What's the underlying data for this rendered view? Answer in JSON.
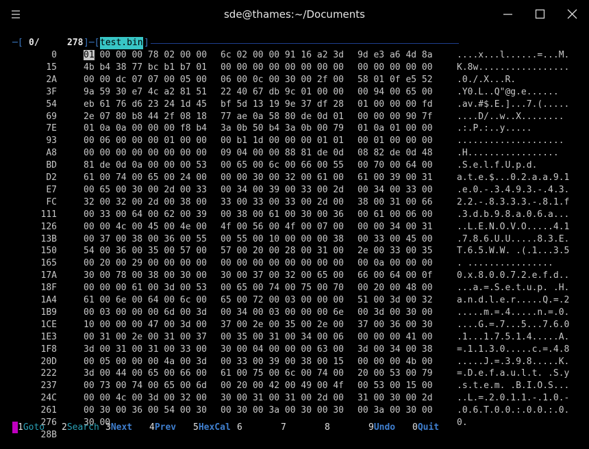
{
  "window": {
    "title": "sde@thames:~/Documents"
  },
  "header": {
    "lead": "─[",
    "offset": "0/",
    "size": "278",
    "mid": "]─[",
    "filename": "test.bin",
    "tail": "]"
  },
  "rows": [
    {
      "offset": "0",
      "g1": "01 00 00 00 78 02 00 00",
      "g2": "6c 02 00 00 91 16 a2 3d",
      "g3": "9d e3 a6 4d 8a",
      "ascii": "....x...l......=...M."
    },
    {
      "offset": "15",
      "g1": "4b b4 38 77 bc b1 b7 01",
      "g2": "00 00 00 00 00 00 00 00",
      "g3": "00 00 00 00 00",
      "ascii": "K.8w................."
    },
    {
      "offset": "2A",
      "g1": "00 00 dc 07 07 00 05 00",
      "g2": "06 00 0c 00 30 00 2f 00",
      "g3": "58 01 0f e5 52",
      "ascii": ".0./.X...R."
    },
    {
      "offset": "3F",
      "g1": "9a 59 30 e7 4c a2 81 51",
      "g2": "22 40 67 db 9c 01 00 00",
      "g3": "00 94 00 65 00",
      "ascii": ".Y0.L..Q\"@g.e......"
    },
    {
      "offset": "54",
      "g1": "eb 61 76 d6 23 24 1d 45",
      "g2": "bf 5d 13 19 9e 37 df 28",
      "g3": "01 00 00 00 fd",
      "ascii": ".av.#$.E.]...7.(....."
    },
    {
      "offset": "69",
      "g1": "2e 07 80 b8 44 2f 08 18",
      "g2": "77 ae 0a 58 80 de 0d 01",
      "g3": "00 00 00 90 7f",
      "ascii": "....D/..w..X........"
    },
    {
      "offset": "7E",
      "g1": "01 0a 0a 00 00 00 f8 b4",
      "g2": "3a 0b 50 b4 3a 0b 00 79",
      "g3": "01 0a 01 00 00",
      "ascii": ".:.P.:..y....."
    },
    {
      "offset": "93",
      "g1": "00 06 00 00 00 01 00 00",
      "g2": "00 b1 1d 00 00 00 01 01",
      "g3": "00 01 00 00 00",
      "ascii": "...................."
    },
    {
      "offset": "A8",
      "g1": "00 00 00 00 00 00 00 00",
      "g2": "09 04 00 00 88 81 de 0d",
      "g3": "08 82 de 0d 48",
      "ascii": ".H................."
    },
    {
      "offset": "BD",
      "g1": "81 de 0d 0a 00 00 00 53",
      "g2": "00 65 00 6c 00 66 00 55",
      "g3": "00 70 00 64 00",
      "ascii": ".S.e.l.f.U.p.d."
    },
    {
      "offset": "D2",
      "g1": "61 00 74 00 65 00 24 00",
      "g2": "00 00 30 00 32 00 61 00",
      "g3": "61 00 39 00 31",
      "ascii": "a.t.e.$...0.2.a.a.9.1"
    },
    {
      "offset": "E7",
      "g1": "00 65 00 30 00 2d 00 33",
      "g2": "00 34 00 39 00 33 00 2d",
      "g3": "00 34 00 33 00",
      "ascii": ".e.0.-.3.4.9.3.-.4.3."
    },
    {
      "offset": "FC",
      "g1": "32 00 32 00 2d 00 38 00",
      "g2": "33 00 33 00 33 00 2d 00",
      "g3": "38 00 31 00 66",
      "ascii": "2.2.-.8.3.3.3.-.8.1.f"
    },
    {
      "offset": "111",
      "g1": "00 33 00 64 00 62 00 39",
      "g2": "00 38 00 61 00 30 00 36",
      "g3": "00 61 00 06 00",
      "ascii": ".3.d.b.9.8.a.0.6.a..."
    },
    {
      "offset": "126",
      "g1": "00 00 4c 00 45 00 4e 00",
      "g2": "4f 00 56 00 4f 00 07 00",
      "g3": "00 00 34 00 31",
      "ascii": "..L.E.N.O.V.O.....4.1"
    },
    {
      "offset": "13B",
      "g1": "00 37 00 38 00 36 00 55",
      "g2": "00 55 00 10 00 00 00 38",
      "g3": "00 33 00 45 00",
      "ascii": ".7.8.6.U.U.....8.3.E."
    },
    {
      "offset": "150",
      "g1": "54 00 36 00 35 00 57 00",
      "g2": "57 00 20 00 28 00 31 00",
      "g3": "2e 00 33 00 35",
      "ascii": "T.6.5.W.W. .(.1...3.5"
    },
    {
      "offset": "165",
      "g1": "00 20 00 29 00 00 00 00",
      "g2": "00 00 00 00 00 00 00 00",
      "g3": "00 0a 00 00 00",
      "ascii": ". ................"
    },
    {
      "offset": "17A",
      "g1": "30 00 78 00 38 00 30 00",
      "g2": "30 00 37 00 32 00 65 00",
      "g3": "66 00 64 00 0f",
      "ascii": "0.x.8.0.0.7.2.e.f.d.."
    },
    {
      "offset": "18F",
      "g1": "00 00 00 61 00 3d 00 53",
      "g2": "00 65 00 74 00 75 00 70",
      "g3": "00 20 00 48 00",
      "ascii": "...a.=.S.e.t.u.p. .H."
    },
    {
      "offset": "1A4",
      "g1": "61 00 6e 00 64 00 6c 00",
      "g2": "65 00 72 00 03 00 00 00",
      "g3": "51 00 3d 00 32",
      "ascii": "a.n.d.l.e.r.....Q.=.2"
    },
    {
      "offset": "1B9",
      "g1": "00 03 00 00 00 6d 00 3d",
      "g2": "00 34 00 03 00 00 00 6e",
      "g3": "00 3d 00 30 00",
      "ascii": ".....m.=.4.....n.=.0."
    },
    {
      "offset": "1CE",
      "g1": "10 00 00 00 47 00 3d 00",
      "g2": "37 00 2e 00 35 00 2e 00",
      "g3": "37 00 36 00 30",
      "ascii": "....G.=.7...5...7.6.0"
    },
    {
      "offset": "1E3",
      "g1": "00 31 00 2e 00 31 00 37",
      "g2": "00 35 00 31 00 34 00 06",
      "g3": "00 00 00 41 00",
      "ascii": ".1...1.7.5.1.4.....A."
    },
    {
      "offset": "1F8",
      "g1": "3d 00 31 00 31 00 33 00",
      "g2": "30 00 04 00 00 00 63 00",
      "g3": "3d 00 34 00 38",
      "ascii": "=.1.1.3.0.....c.=.4.8"
    },
    {
      "offset": "20D",
      "g1": "00 05 00 00 00 4a 00 3d",
      "g2": "00 33 00 39 00 38 00 15",
      "g3": "00 00 00 4b 00",
      "ascii": ".....J.=.3.9.8.....K."
    },
    {
      "offset": "222",
      "g1": "3d 00 44 00 65 00 66 00",
      "g2": "61 00 75 00 6c 00 74 00",
      "g3": "20 00 53 00 79",
      "ascii": "=.D.e.f.a.u.l.t. .S.y"
    },
    {
      "offset": "237",
      "g1": "00 73 00 74 00 65 00 6d",
      "g2": "00 20 00 42 00 49 00 4f",
      "g3": "00 53 00 15 00",
      "ascii": ".s.t.e.m. .B.I.O.S..."
    },
    {
      "offset": "24C",
      "g1": "00 00 4c 00 3d 00 32 00",
      "g2": "30 00 31 00 31 00 2d 00",
      "g3": "31 00 30 00 2d",
      "ascii": "..L.=.2.0.1.1.-.1.0.-"
    },
    {
      "offset": "261",
      "g1": "00 30 00 36 00 54 00 30",
      "g2": "00 30 00 3a 00 30 00 30",
      "g3": "00 3a 00 30 00",
      "ascii": ".0.6.T.0.0.:.0.0.:.0."
    },
    {
      "offset": "276",
      "g1": "30 00",
      "g2": "",
      "g3": "",
      "ascii": "0."
    },
    {
      "offset": "28B",
      "g1": "",
      "g2": "",
      "g3": "",
      "ascii": ""
    }
  ],
  "cursor_byte": "01",
  "footer": [
    {
      "num": "1",
      "label": "Goto"
    },
    {
      "num": "2",
      "label": "Search"
    },
    {
      "num": "3",
      "label": "Next"
    },
    {
      "num": "4",
      "label": "Prev"
    },
    {
      "num": "5",
      "label": "HexCal"
    },
    {
      "num": "6",
      "label": ""
    },
    {
      "num": "7",
      "label": ""
    },
    {
      "num": "8",
      "label": ""
    },
    {
      "num": "9",
      "label": "Undo"
    },
    {
      "num": "0",
      "label": "Quit"
    }
  ]
}
